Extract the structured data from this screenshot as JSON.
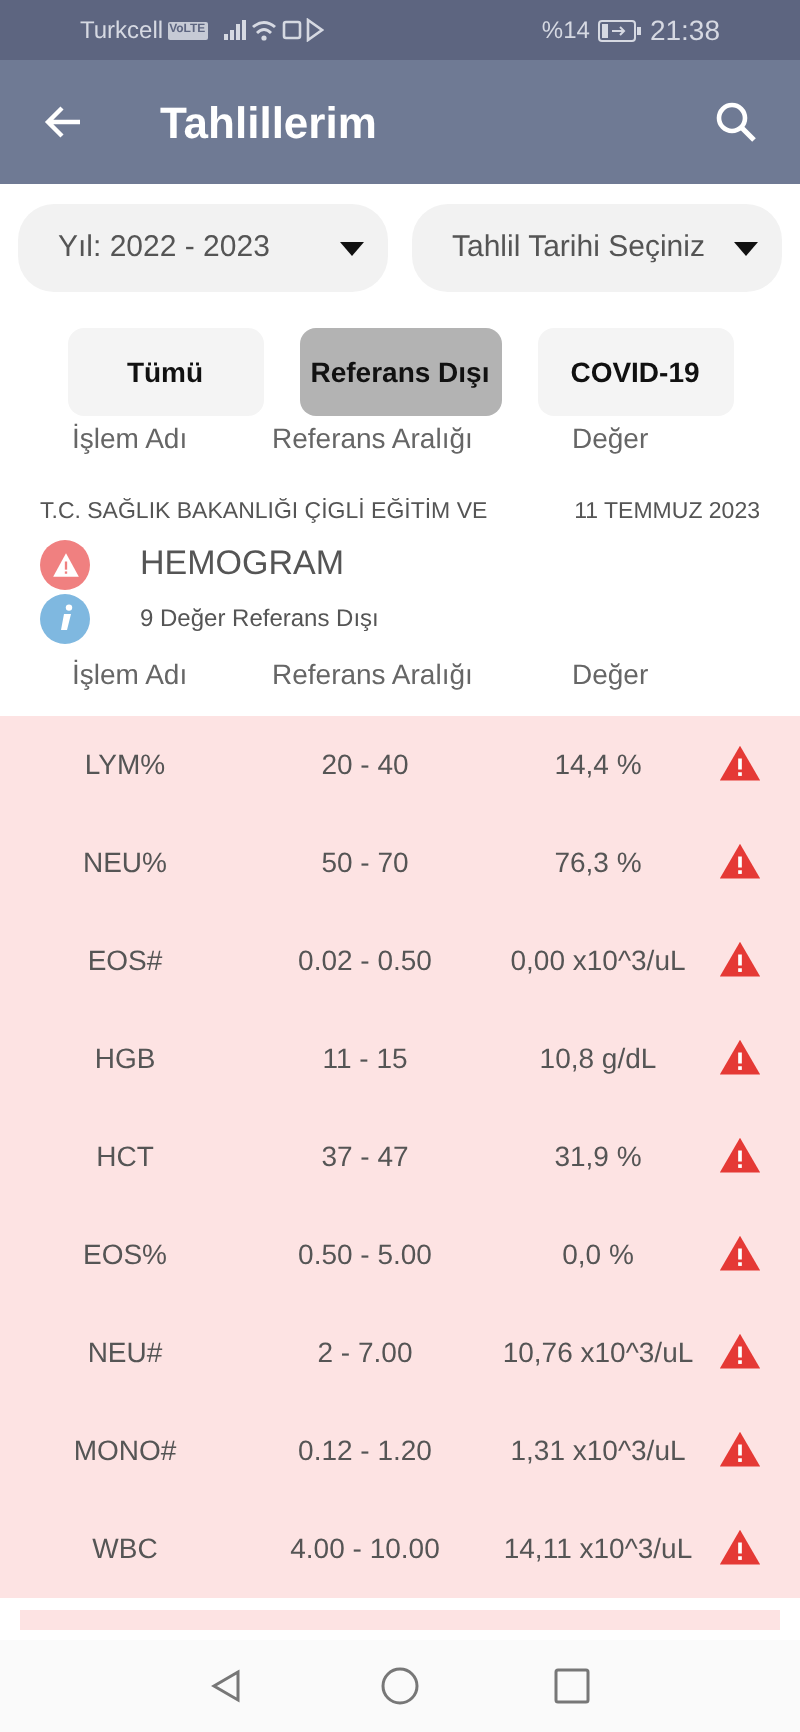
{
  "status_bar": {
    "carrier": "Turkcell",
    "badge": "VoLTE",
    "battery": "%14",
    "time": "21:38"
  },
  "app_bar": {
    "title": "Tahlillerim"
  },
  "dropdowns": [
    {
      "value": "Yıl: 2022 - 2023"
    },
    {
      "value": "Tahlil Tarihi Seçiniz"
    }
  ],
  "filters": [
    {
      "label": "Tümü",
      "selected": false
    },
    {
      "label": "Referans Dışı",
      "selected": true
    },
    {
      "label": "COVID-19",
      "selected": false
    }
  ],
  "previous_header": [
    "İşlem Adı",
    "Referans Aralığı",
    "Değer"
  ],
  "report": {
    "hospital": "T.C. SAĞLIK BAKANLIĞI ÇİGLİ EĞİTİM VE",
    "date": "11 TEMMUZ 2023",
    "title": "HEMOGRAM",
    "summary": "9 Değer Referans Dışı",
    "columns": [
      "İşlem Adı",
      "Referans Aralığı",
      "Değer"
    ],
    "rows": [
      {
        "name": "LYM%",
        "range": "20 - 40",
        "value": "14,4 %",
        "out_of_range": true
      },
      {
        "name": "NEU%",
        "range": "50 - 70",
        "value": "76,3 %",
        "out_of_range": true
      },
      {
        "name": "EOS#",
        "range": "0.02 - 0.50",
        "value": "0,00 x10^3/uL",
        "out_of_range": true
      },
      {
        "name": "HGB",
        "range": "11 - 15",
        "value": "10,8 g/dL",
        "out_of_range": true
      },
      {
        "name": "HCT",
        "range": "37 - 47",
        "value": "31,9 %",
        "out_of_range": true
      },
      {
        "name": "EOS%",
        "range": "0.50 - 5.00",
        "value": "0,0 %",
        "out_of_range": true
      },
      {
        "name": "NEU#",
        "range": "2 - 7.00",
        "value": "10,76 x10^3/uL",
        "out_of_range": true
      },
      {
        "name": "MONO#",
        "range": "0.12 - 1.20",
        "value": "1,31 x10^3/uL",
        "out_of_range": true
      },
      {
        "name": "WBC",
        "range": "4.00 - 10.00",
        "value": "14,11 x10^3/uL",
        "out_of_range": true
      }
    ]
  }
}
